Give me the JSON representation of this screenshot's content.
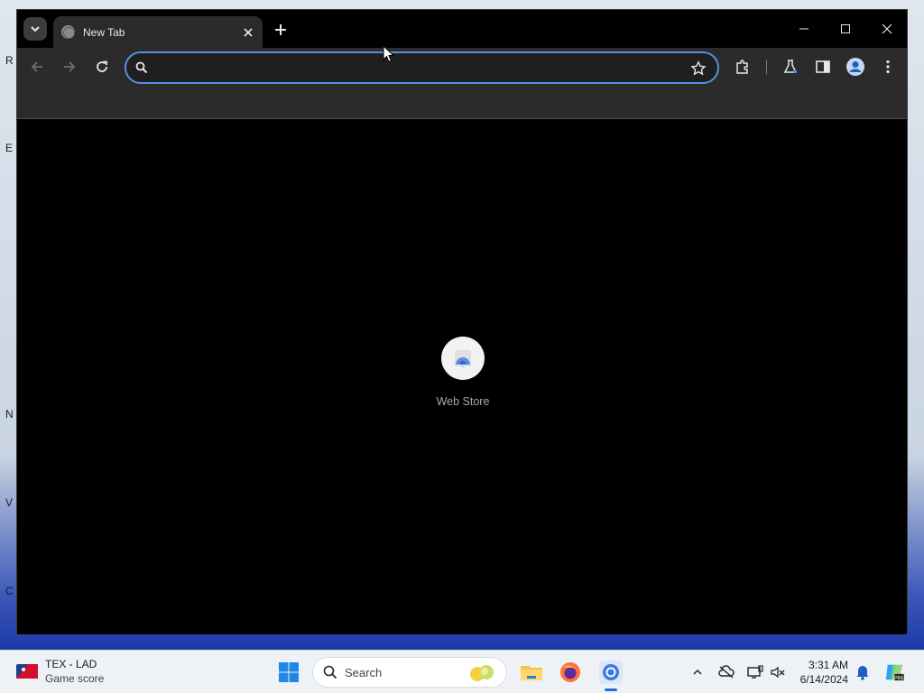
{
  "browser": {
    "tab": {
      "title": "New Tab"
    },
    "omnibox": {
      "value": "",
      "placeholder": ""
    },
    "shortcuts": [
      {
        "label": "Web Store",
        "icon": "web-store-icon"
      }
    ]
  },
  "taskbar": {
    "widget": {
      "title": "TEX - LAD",
      "subtitle": "Game score"
    },
    "search": {
      "placeholder": "Search"
    },
    "clock": {
      "time": "3:31 AM",
      "date": "6/14/2024"
    }
  },
  "colors": {
    "accent": "#5a8fe0",
    "tab_bg": "#2b2b2b",
    "page_bg": "#000000",
    "taskbar_bg": "#eef1f6"
  }
}
